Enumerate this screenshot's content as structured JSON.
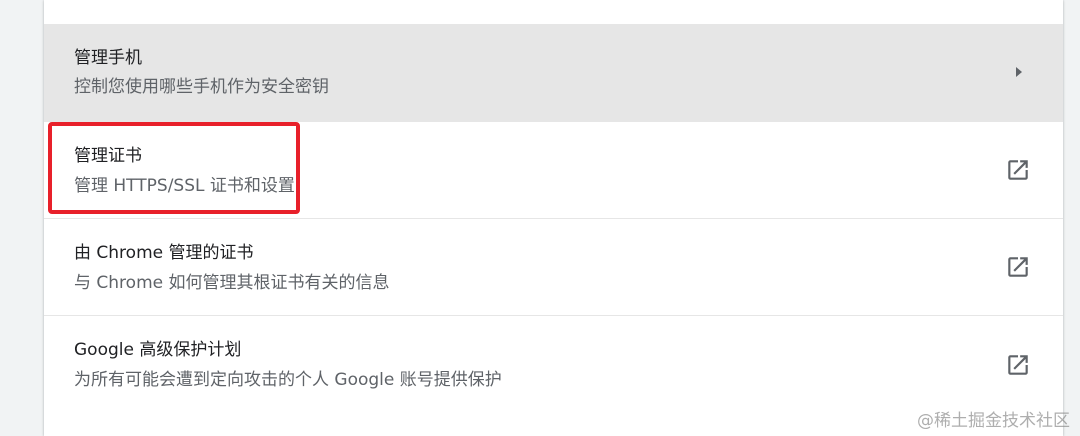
{
  "rows": [
    {
      "title": "管理手机",
      "subtitle": "控制您使用哪些手机作为安全密钥",
      "icon": "chevron-right-icon"
    },
    {
      "title": "管理证书",
      "subtitle": "管理 HTTPS/SSL 证书和设置",
      "icon": "open-in-new-icon"
    },
    {
      "title": "由 Chrome 管理的证书",
      "subtitle": "与 Chrome 如何管理其根证书有关的信息",
      "icon": "open-in-new-icon"
    },
    {
      "title": "Google 高级保护计划",
      "subtitle": "为所有可能会遭到定向攻击的个人 Google 账号提供保护",
      "icon": "open-in-new-icon"
    }
  ],
  "watermark": "@稀土掘金技术社区",
  "colors": {
    "hover_row": "#e6e6e6",
    "highlight": "#e8202a",
    "primary_text": "#202124",
    "secondary_text": "#5f6368"
  }
}
